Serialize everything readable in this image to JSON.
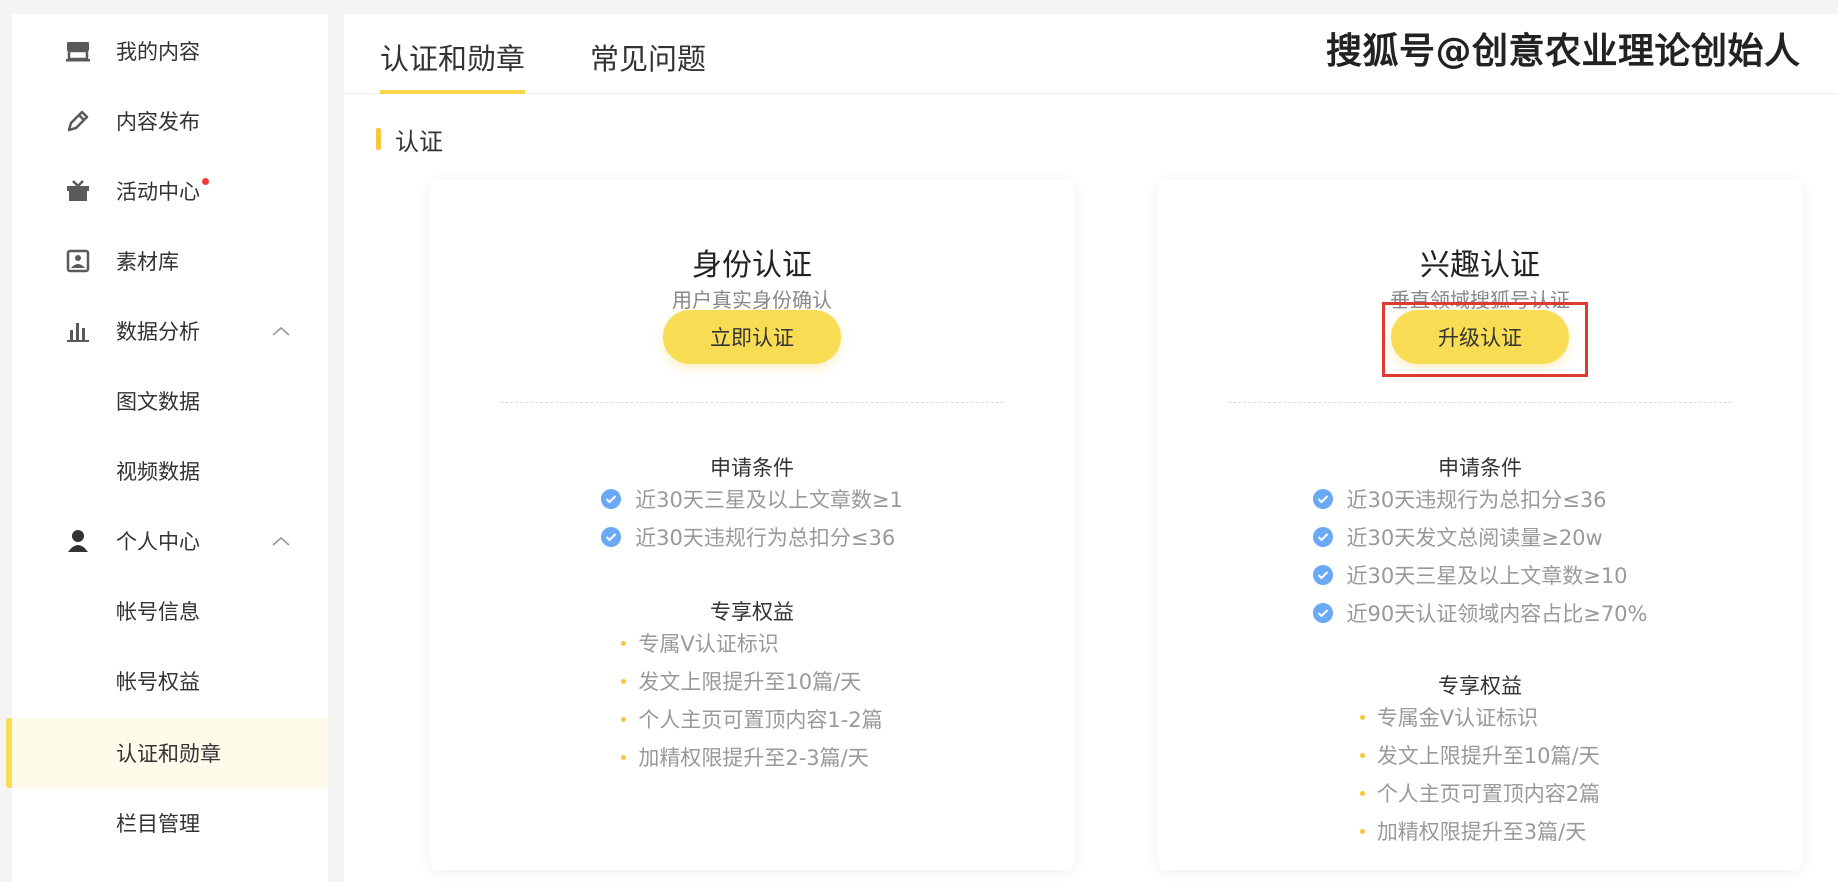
{
  "sidebar": {
    "items": [
      {
        "label": "我的内容",
        "icon": "store-icon"
      },
      {
        "label": "内容发布",
        "icon": "pencil-icon"
      },
      {
        "label": "活动中心",
        "icon": "gift-icon",
        "has_dot": true
      },
      {
        "label": "素材库",
        "icon": "image-library-icon"
      },
      {
        "label": "数据分析",
        "icon": "bar-chart-icon",
        "expanded": true
      },
      {
        "label": "图文数据"
      },
      {
        "label": "视频数据"
      },
      {
        "label": "个人中心",
        "icon": "user-icon",
        "expanded": true
      },
      {
        "label": "帐号信息"
      },
      {
        "label": "帐号权益"
      },
      {
        "label": "认证和勋章",
        "active": true
      },
      {
        "label": "栏目管理"
      }
    ]
  },
  "tabs": [
    {
      "label": "认证和勋章",
      "active": true
    },
    {
      "label": "常见问题"
    }
  ],
  "watermark": "搜狐号@创意农业理论创始人",
  "section": {
    "title": "认证"
  },
  "cards": [
    {
      "title": "身份认证",
      "subtitle": "用户真实身份确认",
      "button": "立即认证",
      "conditions_title": "申请条件",
      "conditions": [
        "近30天三星及以上文章数≥1",
        "近30天违规行为总扣分≤36"
      ],
      "benefits_title": "专享权益",
      "benefits": [
        "专属V认证标识",
        "发文上限提升至10篇/天",
        "个人主页可置顶内容1-2篇",
        "加精权限提升至2-3篇/天"
      ]
    },
    {
      "title": "兴趣认证",
      "subtitle": "垂直领域搜狐号认证",
      "button": "升级认证",
      "highlighted": true,
      "conditions_title": "申请条件",
      "conditions": [
        "近30天违规行为总扣分≤36",
        "近30天发文总阅读量≥20w",
        "近30天三星及以上文章数≥10",
        "近90天认证领域内容占比≥70%"
      ],
      "benefits_title": "专享权益",
      "benefits": [
        "专属金V认证标识",
        "发文上限提升至10篇/天",
        "个人主页可置顶内容2篇",
        "加精权限提升至3篇/天"
      ]
    }
  ],
  "colors": {
    "accent": "#f8dc54",
    "check": "#6aa9f5",
    "highlight": "#e03a2f"
  }
}
